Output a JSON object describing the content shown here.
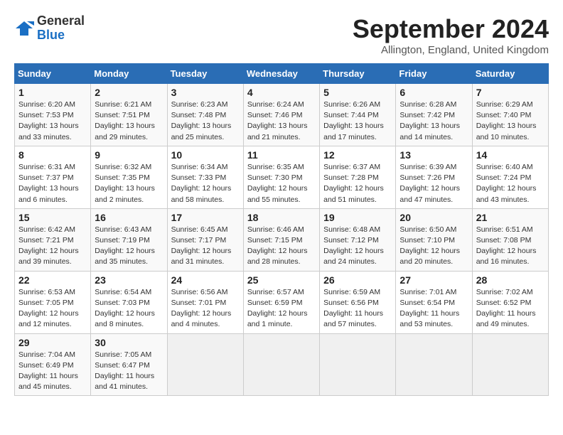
{
  "logo": {
    "general": "General",
    "blue": "Blue"
  },
  "title": "September 2024",
  "location": "Allington, England, United Kingdom",
  "days_of_week": [
    "Sunday",
    "Monday",
    "Tuesday",
    "Wednesday",
    "Thursday",
    "Friday",
    "Saturday"
  ],
  "weeks": [
    [
      {
        "day": "1",
        "sunrise": "6:20 AM",
        "sunset": "7:53 PM",
        "daylight": "13 hours and 33 minutes."
      },
      {
        "day": "2",
        "sunrise": "6:21 AM",
        "sunset": "7:51 PM",
        "daylight": "13 hours and 29 minutes."
      },
      {
        "day": "3",
        "sunrise": "6:23 AM",
        "sunset": "7:48 PM",
        "daylight": "13 hours and 25 minutes."
      },
      {
        "day": "4",
        "sunrise": "6:24 AM",
        "sunset": "7:46 PM",
        "daylight": "13 hours and 21 minutes."
      },
      {
        "day": "5",
        "sunrise": "6:26 AM",
        "sunset": "7:44 PM",
        "daylight": "13 hours and 17 minutes."
      },
      {
        "day": "6",
        "sunrise": "6:28 AM",
        "sunset": "7:42 PM",
        "daylight": "13 hours and 14 minutes."
      },
      {
        "day": "7",
        "sunrise": "6:29 AM",
        "sunset": "7:40 PM",
        "daylight": "13 hours and 10 minutes."
      }
    ],
    [
      {
        "day": "8",
        "sunrise": "6:31 AM",
        "sunset": "7:37 PM",
        "daylight": "13 hours and 6 minutes."
      },
      {
        "day": "9",
        "sunrise": "6:32 AM",
        "sunset": "7:35 PM",
        "daylight": "13 hours and 2 minutes."
      },
      {
        "day": "10",
        "sunrise": "6:34 AM",
        "sunset": "7:33 PM",
        "daylight": "12 hours and 58 minutes."
      },
      {
        "day": "11",
        "sunrise": "6:35 AM",
        "sunset": "7:30 PM",
        "daylight": "12 hours and 55 minutes."
      },
      {
        "day": "12",
        "sunrise": "6:37 AM",
        "sunset": "7:28 PM",
        "daylight": "12 hours and 51 minutes."
      },
      {
        "day": "13",
        "sunrise": "6:39 AM",
        "sunset": "7:26 PM",
        "daylight": "12 hours and 47 minutes."
      },
      {
        "day": "14",
        "sunrise": "6:40 AM",
        "sunset": "7:24 PM",
        "daylight": "12 hours and 43 minutes."
      }
    ],
    [
      {
        "day": "15",
        "sunrise": "6:42 AM",
        "sunset": "7:21 PM",
        "daylight": "12 hours and 39 minutes."
      },
      {
        "day": "16",
        "sunrise": "6:43 AM",
        "sunset": "7:19 PM",
        "daylight": "12 hours and 35 minutes."
      },
      {
        "day": "17",
        "sunrise": "6:45 AM",
        "sunset": "7:17 PM",
        "daylight": "12 hours and 31 minutes."
      },
      {
        "day": "18",
        "sunrise": "6:46 AM",
        "sunset": "7:15 PM",
        "daylight": "12 hours and 28 minutes."
      },
      {
        "day": "19",
        "sunrise": "6:48 AM",
        "sunset": "7:12 PM",
        "daylight": "12 hours and 24 minutes."
      },
      {
        "day": "20",
        "sunrise": "6:50 AM",
        "sunset": "7:10 PM",
        "daylight": "12 hours and 20 minutes."
      },
      {
        "day": "21",
        "sunrise": "6:51 AM",
        "sunset": "7:08 PM",
        "daylight": "12 hours and 16 minutes."
      }
    ],
    [
      {
        "day": "22",
        "sunrise": "6:53 AM",
        "sunset": "7:05 PM",
        "daylight": "12 hours and 12 minutes."
      },
      {
        "day": "23",
        "sunrise": "6:54 AM",
        "sunset": "7:03 PM",
        "daylight": "12 hours and 8 minutes."
      },
      {
        "day": "24",
        "sunrise": "6:56 AM",
        "sunset": "7:01 PM",
        "daylight": "12 hours and 4 minutes."
      },
      {
        "day": "25",
        "sunrise": "6:57 AM",
        "sunset": "6:59 PM",
        "daylight": "12 hours and 1 minute."
      },
      {
        "day": "26",
        "sunrise": "6:59 AM",
        "sunset": "6:56 PM",
        "daylight": "11 hours and 57 minutes."
      },
      {
        "day": "27",
        "sunrise": "7:01 AM",
        "sunset": "6:54 PM",
        "daylight": "11 hours and 53 minutes."
      },
      {
        "day": "28",
        "sunrise": "7:02 AM",
        "sunset": "6:52 PM",
        "daylight": "11 hours and 49 minutes."
      }
    ],
    [
      {
        "day": "29",
        "sunrise": "7:04 AM",
        "sunset": "6:49 PM",
        "daylight": "11 hours and 45 minutes."
      },
      {
        "day": "30",
        "sunrise": "7:05 AM",
        "sunset": "6:47 PM",
        "daylight": "11 hours and 41 minutes."
      },
      null,
      null,
      null,
      null,
      null
    ]
  ]
}
